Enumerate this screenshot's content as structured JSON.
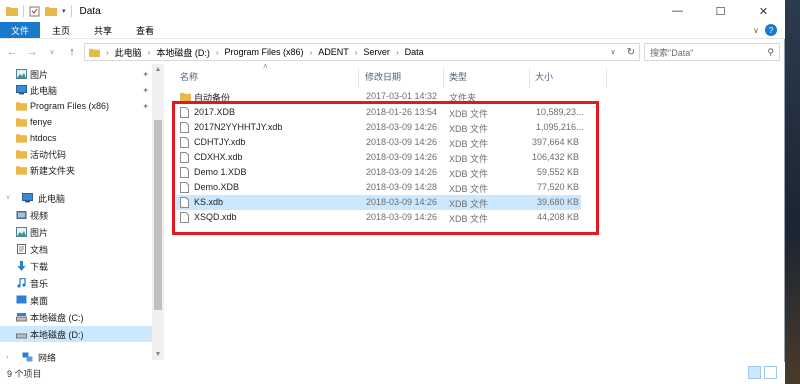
{
  "window": {
    "title": "Data",
    "controls": {
      "minimize": "—",
      "maximize": "☐",
      "close": "✕"
    }
  },
  "ribbon": {
    "tabs": [
      "文件",
      "主页",
      "共享",
      "查看"
    ]
  },
  "address": {
    "crumbs": [
      "此电脑",
      "本地磁盘 (D:)",
      "Program Files (x86)",
      "ADENT",
      "Server",
      "Data"
    ],
    "search_placeholder": "搜索\"Data\""
  },
  "nav": {
    "quick_access": [
      {
        "label": "图片",
        "icon": "pictures-icon",
        "pinned": true
      },
      {
        "label": "此电脑",
        "icon": "computer-icon",
        "pinned": true
      },
      {
        "label": "Program Files (x86)",
        "icon": "folder-icon",
        "pinned": true
      },
      {
        "label": "fenye",
        "icon": "folder-icon",
        "pinned": false
      },
      {
        "label": "htdocs",
        "icon": "folder-icon",
        "pinned": false
      },
      {
        "label": "活动代码",
        "icon": "folder-icon",
        "pinned": false
      },
      {
        "label": "新建文件夹",
        "icon": "folder-icon",
        "pinned": false
      }
    ],
    "this_pc": {
      "label": "此电脑",
      "icon": "computer-icon"
    },
    "pc_items": [
      {
        "label": "视频",
        "icon": "video-icon"
      },
      {
        "label": "图片",
        "icon": "pictures-icon"
      },
      {
        "label": "文档",
        "icon": "documents-icon"
      },
      {
        "label": "下载",
        "icon": "download-icon"
      },
      {
        "label": "音乐",
        "icon": "music-icon"
      },
      {
        "label": "桌面",
        "icon": "desktop-icon"
      },
      {
        "label": "本地磁盘 (C:)",
        "icon": "drive-icon"
      },
      {
        "label": "本地磁盘 (D:)",
        "icon": "drive-icon",
        "selected": true
      }
    ],
    "network": {
      "label": "网络",
      "icon": "network-icon"
    }
  },
  "columns": {
    "name": "名称",
    "date": "修改日期",
    "type": "类型",
    "size": "大小"
  },
  "folder_row": {
    "name": "自动备份",
    "date": "2017-03-01 14:32",
    "type": "文件夹",
    "size": ""
  },
  "files": [
    {
      "name": "2017.XDB",
      "date": "2018-01-26 13:54",
      "type": "XDB 文件",
      "size": "10,589,23..."
    },
    {
      "name": "2017N2YYHHTJY.xdb",
      "date": "2018-03-09 14:26",
      "type": "XDB 文件",
      "size": "1,095,216..."
    },
    {
      "name": "CDHTJY.xdb",
      "date": "2018-03-09 14:26",
      "type": "XDB 文件",
      "size": "397,664 KB"
    },
    {
      "name": "CDXHX.xdb",
      "date": "2018-03-09 14:26",
      "type": "XDB 文件",
      "size": "106,432 KB"
    },
    {
      "name": "Demo 1.XDB",
      "date": "2018-03-09 14:26",
      "type": "XDB 文件",
      "size": "59,552 KB"
    },
    {
      "name": "Demo.XDB",
      "date": "2018-03-09 14:28",
      "type": "XDB 文件",
      "size": "77,520 KB"
    },
    {
      "name": "KS.xdb",
      "date": "2018-03-09 14:26",
      "type": "XDB 文件",
      "size": "39,680 KB",
      "selected": true
    },
    {
      "name": "XSQD.xdb",
      "date": "2018-03-09 14:26",
      "type": "XDB 文件",
      "size": "44,208 KB"
    }
  ],
  "status": {
    "count": "9 个项目"
  },
  "colors": {
    "accent": "#1979ca",
    "highlight_box": "#e0191f",
    "selection": "#cce8ff"
  }
}
